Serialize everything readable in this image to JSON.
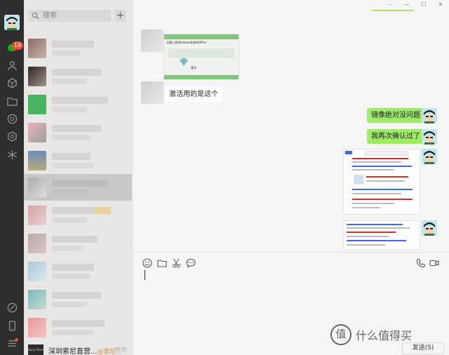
{
  "nav": {
    "unread_count": "19"
  },
  "contacts": {
    "search_placeholder": "搜索",
    "add_label": "+"
  },
  "last_conversation": {
    "avatar_text": "Sony Store",
    "name": "深圳索尼直营...",
    "sender": "@索尼...",
    "time": "昨天"
  },
  "window": {
    "min": "—",
    "max": "☐",
    "close": "✕",
    "more": "⋯"
  },
  "messages": [
    {
      "side": "left",
      "type": "image"
    },
    {
      "side": "left",
      "type": "text",
      "text": "激活用的是这个"
    },
    {
      "side": "right",
      "type": "text",
      "text": "镜像绝对没问题"
    },
    {
      "side": "right",
      "type": "text",
      "text": "我再次确认过了"
    },
    {
      "side": "right",
      "type": "image"
    },
    {
      "side": "right",
      "type": "image"
    }
  ],
  "left_image": {
    "title": "天翼工具Windows系统和Office",
    "button": "激活"
  },
  "composer": {
    "send_label": "发送(S)"
  },
  "watermark": {
    "icon_text": "值",
    "text": "什么值得买"
  },
  "colors": {
    "nav_bg": "#2e2e2e",
    "list_bg": "#e8e7e6",
    "my_bubble": "#9eea6a",
    "badge": "#f74c31"
  }
}
